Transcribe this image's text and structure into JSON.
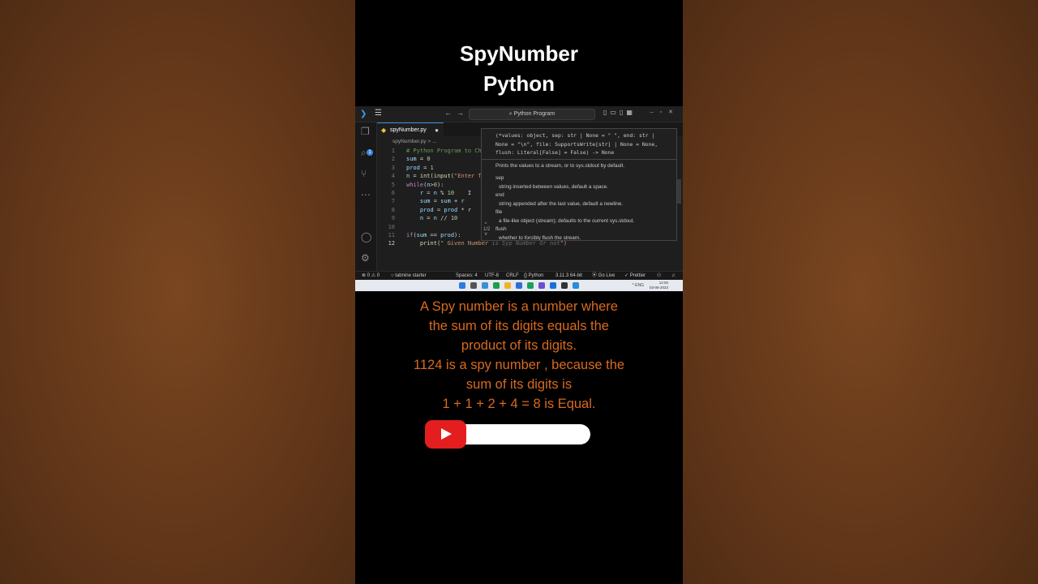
{
  "title": {
    "line1": "SpyNumber",
    "line2": "Python"
  },
  "vscode": {
    "search_text": "Python Program",
    "tab": {
      "filename": "spyNumber.py",
      "dirty": "●"
    },
    "breadcrumb": "spyNumber.py > ...",
    "activity_badge": "1",
    "code_lines": [
      {
        "n": "1",
        "segments": [
          {
            "t": "# Python Program to Ch",
            "c": "c-com"
          }
        ]
      },
      {
        "n": "2",
        "segments": [
          {
            "t": "sum",
            "c": "c-var"
          },
          {
            "t": " = ",
            "c": ""
          },
          {
            "t": "0",
            "c": "c-num"
          }
        ]
      },
      {
        "n": "3",
        "segments": [
          {
            "t": "prod",
            "c": "c-var"
          },
          {
            "t": " = ",
            "c": ""
          },
          {
            "t": "1",
            "c": "c-num"
          }
        ]
      },
      {
        "n": "4",
        "segments": [
          {
            "t": "n",
            "c": "c-var"
          },
          {
            "t": " = ",
            "c": ""
          },
          {
            "t": "int",
            "c": "c-fn"
          },
          {
            "t": "(",
            "c": ""
          },
          {
            "t": "input",
            "c": "c-fn"
          },
          {
            "t": "(",
            "c": ""
          },
          {
            "t": "\"Enter T",
            "c": "c-str"
          }
        ]
      },
      {
        "n": "5",
        "segments": [
          {
            "t": "while",
            "c": "c-kw"
          },
          {
            "t": "(",
            "c": ""
          },
          {
            "t": "n",
            "c": "c-var"
          },
          {
            "t": ">",
            "c": ""
          },
          {
            "t": "0",
            "c": "c-num"
          },
          {
            "t": "):",
            "c": ""
          }
        ]
      },
      {
        "n": "6",
        "segments": [
          {
            "t": "    r",
            "c": "c-var"
          },
          {
            "t": " = ",
            "c": ""
          },
          {
            "t": "n",
            "c": "c-var"
          },
          {
            "t": " % ",
            "c": ""
          },
          {
            "t": "10",
            "c": "c-num"
          },
          {
            "t": "    I",
            "c": ""
          }
        ]
      },
      {
        "n": "7",
        "segments": [
          {
            "t": "    sum",
            "c": "c-var"
          },
          {
            "t": " = ",
            "c": ""
          },
          {
            "t": "sum",
            "c": "c-var"
          },
          {
            "t": " + ",
            "c": ""
          },
          {
            "t": "r",
            "c": "c-var"
          }
        ]
      },
      {
        "n": "8",
        "segments": [
          {
            "t": "    prod",
            "c": "c-var"
          },
          {
            "t": " = ",
            "c": ""
          },
          {
            "t": "prod",
            "c": "c-var"
          },
          {
            "t": " * ",
            "c": ""
          },
          {
            "t": "r",
            "c": "c-var"
          }
        ]
      },
      {
        "n": "9",
        "segments": [
          {
            "t": "    n",
            "c": "c-var"
          },
          {
            "t": " = ",
            "c": ""
          },
          {
            "t": "n",
            "c": "c-var"
          },
          {
            "t": " // ",
            "c": ""
          },
          {
            "t": "10",
            "c": "c-num"
          }
        ]
      },
      {
        "n": "10",
        "segments": []
      },
      {
        "n": "11",
        "segments": [
          {
            "t": "if",
            "c": "c-kw"
          },
          {
            "t": "(",
            "c": ""
          },
          {
            "t": "sum",
            "c": "c-var"
          },
          {
            "t": " == ",
            "c": ""
          },
          {
            "t": "prod",
            "c": "c-var"
          },
          {
            "t": "):",
            "c": ""
          }
        ]
      },
      {
        "n": "12",
        "segments": [
          {
            "t": "    print",
            "c": "c-fn"
          },
          {
            "t": "(",
            "c": ""
          },
          {
            "t": "\" Given Number",
            "c": "c-str"
          },
          {
            "t": " is Syp Number Or not",
            "c": "c-ghost"
          },
          {
            "t": "\")",
            "c": "c-str"
          }
        ]
      }
    ],
    "hover": {
      "signature_lines": [
        "(*values: object, sep: str | None = \" \", end: str |",
        "None = \"\\n\", file: SupportsWrite[str] | None = None,",
        "flush: Literal[False] = False) -> None"
      ],
      "summary": "Prints the values to a stream, or to sys.stdout by default.",
      "params": [
        {
          "name": "sep",
          "desc": "string inserted between values, default a space."
        },
        {
          "name": "end",
          "desc": "string appended after the last value, default a newline."
        },
        {
          "name": "file",
          "desc": "a file-like object (stream); defaults to the current sys.stdout."
        },
        {
          "name": "flush",
          "desc": "whether to forcibly flush the stream."
        }
      ],
      "counter": "1/2"
    },
    "status": {
      "problems": "⊗ 0 ⚠ 0",
      "tabnine": "○ tabnine starter",
      "spaces": "Spaces: 4",
      "encoding": "UTF-8",
      "eol": "CRLF",
      "language": "{} Python",
      "interpreter": "3.11.3 64-bit",
      "golive": "⦿ Go Live",
      "prettier": "✓ Prettier"
    }
  },
  "taskbar": {
    "clock_time": "12:00",
    "clock_date": "03-06-2023",
    "tray": "^ ENG"
  },
  "description": [
    "A Spy number is a number where",
    "the sum of its digits equals the",
    "product of its digits.",
    "1124 is a spy number , because the",
    "sum of its digits is",
    "1 + 1 + 2 + 4 = 8 is Equal."
  ],
  "colors": {
    "accent_orange": "#d96a1f",
    "youtube_red": "#e41e1e",
    "background_brown": "#6a3c1c"
  }
}
